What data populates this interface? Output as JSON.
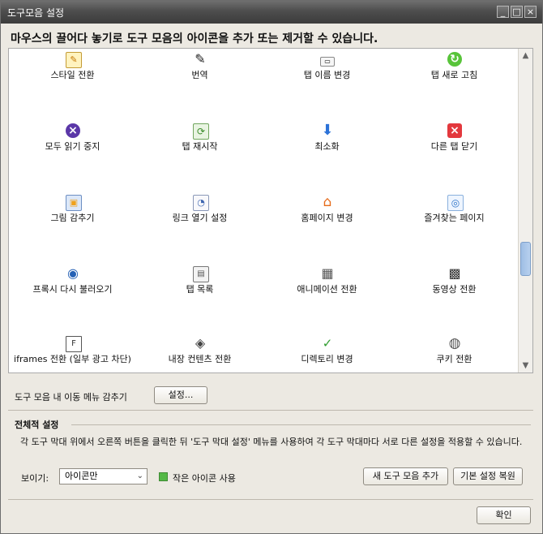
{
  "window": {
    "title": "도구모음 설정",
    "controls": [
      "_",
      "□",
      "×"
    ]
  },
  "header": {
    "instruction": "마우스의 끌어다 놓기로 도구 모음의 아이콘을 추가 또는 제거할 수 있습니다."
  },
  "tools": [
    {
      "label": "스타일 전환",
      "icon": "style-switch-icon"
    },
    {
      "label": "번역",
      "icon": "pencil-icon"
    },
    {
      "label": "탭 이름 변경",
      "icon": "tab-rename-icon"
    },
    {
      "label": "탭 새로 고침",
      "icon": "refresh-icon"
    },
    {
      "label": "모두 읽기 중지",
      "icon": "stop-all-icon"
    },
    {
      "label": "탭 재시작",
      "icon": "restart-tab-icon"
    },
    {
      "label": "최소화",
      "icon": "minimize-arrow-icon"
    },
    {
      "label": "다른 탭 닫기",
      "icon": "close-other-tabs-icon"
    },
    {
      "label": "그림 감추기",
      "icon": "hide-images-icon"
    },
    {
      "label": "링크 열기 설정",
      "icon": "link-open-settings-icon"
    },
    {
      "label": "홈페이지 변경",
      "icon": "home-icon"
    },
    {
      "label": "즐겨찾는 페이지",
      "icon": "favorite-page-icon"
    },
    {
      "label": "프록시 다시 불러오기",
      "icon": "proxy-reload-icon"
    },
    {
      "label": "탭 목록",
      "icon": "tab-list-icon"
    },
    {
      "label": "애니메이션 전환",
      "icon": "animation-toggle-icon"
    },
    {
      "label": "동영상 전환",
      "icon": "video-toggle-icon"
    },
    {
      "label": "iframes 전환 (일부 광고 차단)",
      "icon": "iframe-toggle-icon"
    },
    {
      "label": "내장 컨텐츠 전환",
      "icon": "embedded-content-icon"
    },
    {
      "label": "디렉토리 변경",
      "icon": "abc-check-icon"
    },
    {
      "label": "쿠키 전환",
      "icon": "cookie-icon"
    }
  ],
  "options": {
    "hide_nav_menu_label": "도구 모음 내 이동 메뉴 감추기",
    "settings_button": "설정..."
  },
  "global": {
    "section_title": "전체적 설정",
    "description": "각 도구 막대 위에서 오른쪽 버튼을 클릭한 뒤 '도구 막대 설정' 메뉴를 사용하여 각 도구 막대마다 서로 다른 설정을 적용할 수 있습니다.",
    "show_label": "보이기:",
    "show_value": "아이콘만",
    "small_icons_label": "작은 아이콘 사용",
    "new_toolbar_button": "새 도구 모음 추가",
    "restore_defaults_button": "기본 설정 복원"
  },
  "footer": {
    "ok_button": "확인"
  }
}
